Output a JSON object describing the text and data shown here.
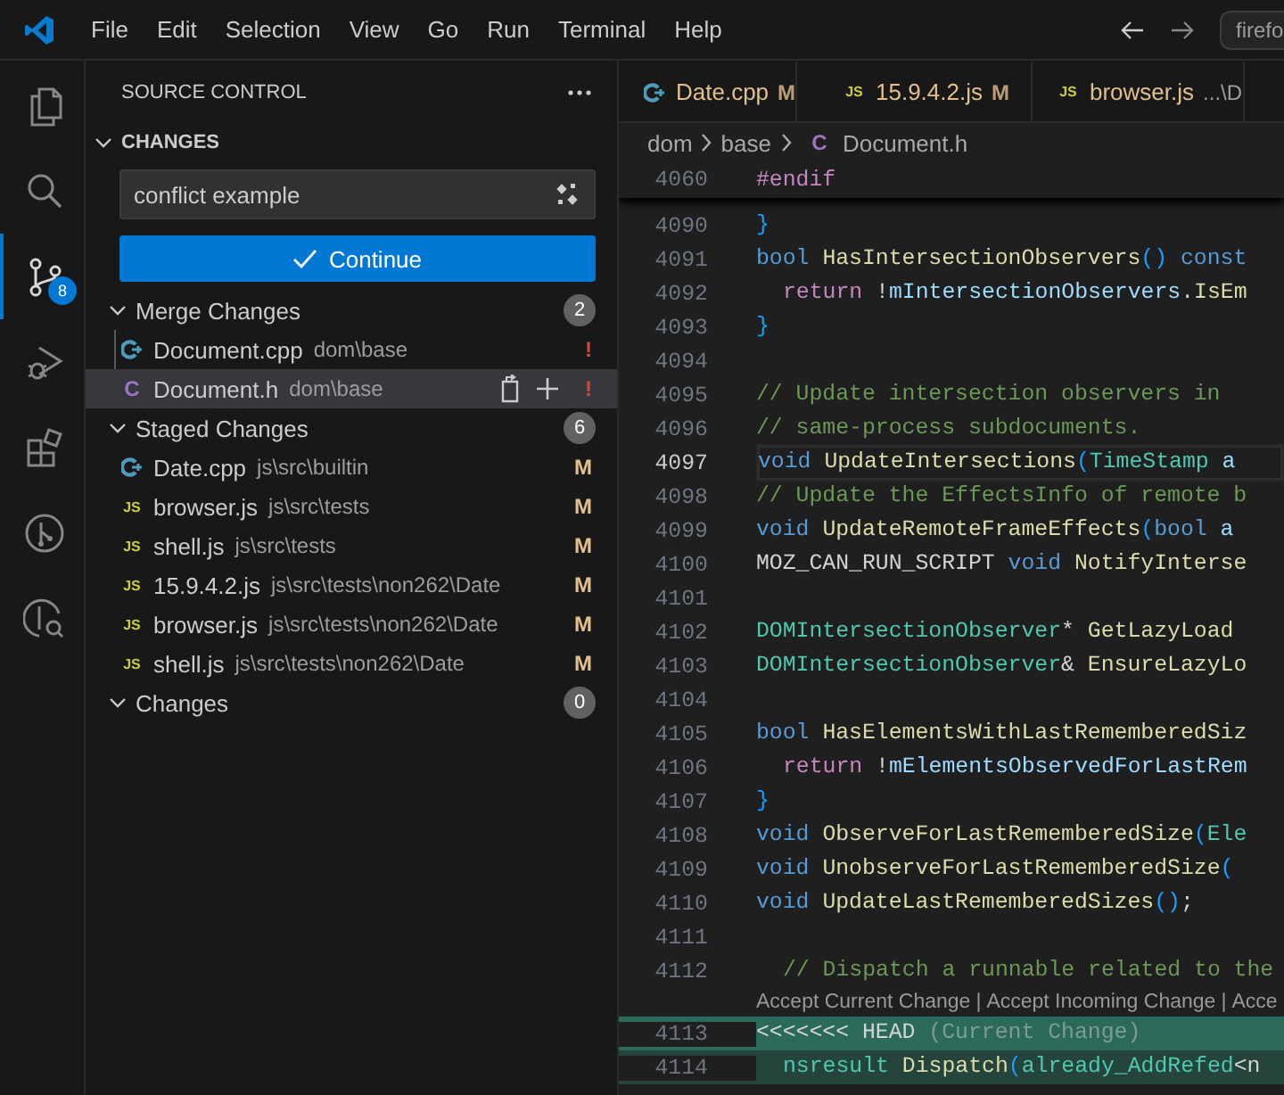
{
  "title_bar": {
    "menu": [
      "File",
      "Edit",
      "Selection",
      "View",
      "Go",
      "Run",
      "Terminal",
      "Help"
    ],
    "command_center": "firefo"
  },
  "activity_bar": [
    {
      "kind": "explorer",
      "selected": false
    },
    {
      "kind": "search",
      "selected": false
    },
    {
      "kind": "source-control",
      "selected": true,
      "badge": "8"
    },
    {
      "kind": "run-debug",
      "selected": false
    },
    {
      "kind": "extensions",
      "selected": false
    },
    {
      "kind": "branch-circle",
      "selected": false
    },
    {
      "kind": "branch-search",
      "selected": false
    }
  ],
  "sidebar": {
    "title": "SOURCE CONTROL",
    "section": {
      "title": "CHANGES",
      "expanded": true
    },
    "commit_message": "conflict example",
    "commit_button": "Continue",
    "groups": [
      {
        "title": "Merge Changes",
        "count": "2",
        "expanded": true,
        "items": [
          {
            "icon": {
              "kind": "cpp"
            },
            "name": "Document.cpp",
            "path": "dom\\base",
            "status": "!",
            "kind": "conflict",
            "selected": false
          },
          {
            "icon": {
              "kind": "c",
              "label": "C"
            },
            "name": "Document.h",
            "path": "dom\\base",
            "status": "!",
            "kind": "conflict",
            "selected": true
          }
        ]
      },
      {
        "title": "Staged Changes",
        "count": "6",
        "expanded": true,
        "items": [
          {
            "icon": {
              "kind": "cpp"
            },
            "name": "Date.cpp",
            "path": "js\\src\\builtin",
            "status": "M",
            "kind": "modified",
            "selected": false
          },
          {
            "icon": {
              "kind": "js",
              "label": "JS"
            },
            "name": "browser.js",
            "path": "js\\src\\tests",
            "status": "M",
            "kind": "modified",
            "selected": false
          },
          {
            "icon": {
              "kind": "js",
              "label": "JS"
            },
            "name": "shell.js",
            "path": "js\\src\\tests",
            "status": "M",
            "kind": "modified",
            "selected": false
          },
          {
            "icon": {
              "kind": "js",
              "label": "JS"
            },
            "name": "15.9.4.2.js",
            "path": "js\\src\\tests\\non262\\Date",
            "status": "M",
            "kind": "modified",
            "selected": false
          },
          {
            "icon": {
              "kind": "js",
              "label": "JS"
            },
            "name": "browser.js",
            "path": "js\\src\\tests\\non262\\Date",
            "status": "M",
            "kind": "modified",
            "selected": false
          },
          {
            "icon": {
              "kind": "js",
              "label": "JS"
            },
            "name": "shell.js",
            "path": "js\\src\\tests\\non262\\Date",
            "status": "M",
            "kind": "modified",
            "selected": false
          }
        ]
      },
      {
        "title": "Changes",
        "count": "0",
        "expanded": true
      }
    ]
  },
  "tabs": [
    {
      "icon": {
        "kind": "cpp"
      },
      "label": "Date.cpp",
      "status": "M",
      "selected": false
    },
    {
      "icon": {
        "kind": "js",
        "label": "JS"
      },
      "label": "15.9.4.2.js",
      "status": "M",
      "selected": false
    },
    {
      "icon": {
        "kind": "js",
        "label": "JS"
      },
      "label": "browser.js",
      "description": "...\\D",
      "selected": false
    }
  ],
  "breadcrumb": {
    "folders": [
      "dom",
      "base"
    ],
    "file": {
      "icon": {
        "kind": "c",
        "label": "C"
      },
      "name": "Document.h"
    }
  },
  "sticky_line": {
    "number": "4060",
    "tokens": [
      {
        "kind": "control",
        "text": "#endif"
      }
    ]
  },
  "code_lines": [
    {
      "number": "4090",
      "tokens": [
        {
          "kind": "bracket",
          "text": "}"
        }
      ]
    },
    {
      "number": "4091",
      "tokens": [
        {
          "kind": "keyword",
          "text": "bool "
        },
        {
          "kind": "function",
          "text": "HasIntersectionObservers"
        },
        {
          "kind": "bracket",
          "text": "() "
        },
        {
          "kind": "keyword",
          "text": "const"
        }
      ]
    },
    {
      "number": "4092",
      "indented": true,
      "tokens": [
        {
          "kind": "control",
          "text": "return"
        },
        {
          "kind": "plain",
          "text": " !"
        },
        {
          "kind": "variable",
          "text": "mIntersectionObservers"
        },
        {
          "kind": "plain",
          "text": "."
        },
        {
          "kind": "function",
          "text": "IsEm"
        }
      ]
    },
    {
      "number": "4093",
      "tokens": [
        {
          "kind": "bracket",
          "text": "}"
        }
      ]
    },
    {
      "number": "4094"
    },
    {
      "number": "4095",
      "tokens": [
        {
          "kind": "comment",
          "text": "// Update intersection observers in"
        }
      ]
    },
    {
      "number": "4096",
      "tokens": [
        {
          "kind": "comment",
          "text": "// same-process subdocuments."
        }
      ]
    },
    {
      "number": "4097",
      "current": true,
      "tokens": [
        {
          "kind": "keyword",
          "text": "void "
        },
        {
          "kind": "function",
          "text": "UpdateIntersections"
        },
        {
          "kind": "bracket",
          "text": "("
        },
        {
          "kind": "type",
          "text": "TimeStamp "
        },
        {
          "kind": "variable",
          "text": "a"
        }
      ]
    },
    {
      "number": "4098",
      "tokens": [
        {
          "kind": "comment",
          "text": "// Update the EffectsInfo of remote b"
        }
      ]
    },
    {
      "number": "4099",
      "tokens": [
        {
          "kind": "keyword",
          "text": "void "
        },
        {
          "kind": "function",
          "text": "UpdateRemoteFrameEffects"
        },
        {
          "kind": "bracket",
          "text": "("
        },
        {
          "kind": "keyword",
          "text": "bool "
        },
        {
          "kind": "variable",
          "text": "a"
        }
      ]
    },
    {
      "number": "4100",
      "tokens": [
        {
          "kind": "plain",
          "text": "MOZ_CAN_RUN_SCRIPT "
        },
        {
          "kind": "keyword",
          "text": "void "
        },
        {
          "kind": "function",
          "text": "NotifyInterse"
        }
      ]
    },
    {
      "number": "4101"
    },
    {
      "number": "4102",
      "tokens": [
        {
          "kind": "type",
          "text": "DOMIntersectionObserver"
        },
        {
          "kind": "plain",
          "text": "* "
        },
        {
          "kind": "function",
          "text": "GetLazyLoad"
        }
      ]
    },
    {
      "number": "4103",
      "tokens": [
        {
          "kind": "type",
          "text": "DOMIntersectionObserver"
        },
        {
          "kind": "plain",
          "text": "& "
        },
        {
          "kind": "function",
          "text": "EnsureLazyLo"
        }
      ]
    },
    {
      "number": "4104"
    },
    {
      "number": "4105",
      "tokens": [
        {
          "kind": "keyword",
          "text": "bool "
        },
        {
          "kind": "function",
          "text": "HasElementsWithLastRememberedSiz"
        }
      ]
    },
    {
      "number": "4106",
      "indented": true,
      "tokens": [
        {
          "kind": "control",
          "text": "return"
        },
        {
          "kind": "plain",
          "text": " !"
        },
        {
          "kind": "variable",
          "text": "mElementsObservedForLastRem"
        }
      ]
    },
    {
      "number": "4107",
      "tokens": [
        {
          "kind": "bracket",
          "text": "}"
        }
      ]
    },
    {
      "number": "4108",
      "tokens": [
        {
          "kind": "keyword",
          "text": "void "
        },
        {
          "kind": "function",
          "text": "ObserveForLastRememberedSize"
        },
        {
          "kind": "bracket",
          "text": "("
        },
        {
          "kind": "type",
          "text": "Ele"
        }
      ]
    },
    {
      "number": "4109",
      "tokens": [
        {
          "kind": "keyword",
          "text": "void "
        },
        {
          "kind": "function",
          "text": "UnobserveForLastRememberedSize"
        },
        {
          "kind": "bracket",
          "text": "("
        }
      ]
    },
    {
      "number": "4110",
      "tokens": [
        {
          "kind": "keyword",
          "text": "void "
        },
        {
          "kind": "function",
          "text": "UpdateLastRememberedSizes"
        },
        {
          "kind": "bracket",
          "text": "()"
        },
        {
          "kind": "plain",
          "text": ";"
        }
      ]
    },
    {
      "number": "4111"
    },
    {
      "number": "4112",
      "indented": true,
      "tokens": [
        {
          "kind": "comment",
          "text": "// Dispatch a runnable related to the"
        }
      ]
    }
  ],
  "code_lens": {
    "actions": [
      "Accept Current Change",
      "Accept Incoming Change",
      "Acce"
    ],
    "separator": "|"
  },
  "conflict_lines": [
    {
      "number": "4113",
      "kind": "header",
      "tokens": [
        {
          "kind": "plain",
          "text": "<<<<<<< HEAD "
        },
        {
          "kind": "dim",
          "text": "(Current Change)"
        }
      ]
    },
    {
      "number": "4114",
      "kind": "body",
      "indented": true,
      "tokens": [
        {
          "kind": "type",
          "text": "nsresult "
        },
        {
          "kind": "function",
          "text": "Dispatch"
        },
        {
          "kind": "bracket",
          "text": "("
        },
        {
          "kind": "type",
          "text": "already_AddRefed"
        },
        {
          "kind": "plain",
          "text": "<n"
        }
      ]
    }
  ]
}
